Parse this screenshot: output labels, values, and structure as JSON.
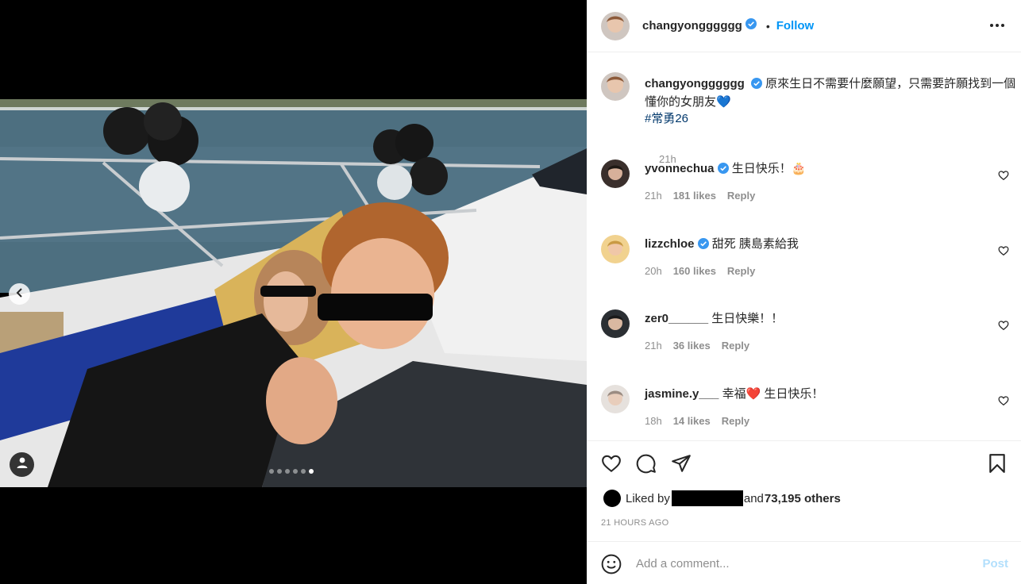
{
  "post": {
    "author": "changyongggggg",
    "follow_label": "Follow",
    "separator": "•",
    "caption_text": "原來生日不需要什麼願望，只需要許願找到一個懂你的女朋友💙",
    "hashtag": "#常勇26",
    "caption_time": "21h"
  },
  "media": {
    "slide_count": 6,
    "active_slide": 6
  },
  "comments": [
    {
      "user": "yvonnechua",
      "verified": true,
      "text": "生日快乐！🎂",
      "time": "21h",
      "likes": "181 likes",
      "reply": "Reply"
    },
    {
      "user": "lizzchloe",
      "verified": true,
      "text": "甜死 胰島素給我",
      "time": "20h",
      "likes": "160 likes",
      "reply": "Reply"
    },
    {
      "user": "zer0______",
      "verified": false,
      "text": "生日快樂！！",
      "time": "21h",
      "likes": "36 likes",
      "reply": "Reply"
    },
    {
      "user": "jasmine.y___",
      "verified": false,
      "text": "幸福❤️ 生日快乐！",
      "time": "18h",
      "likes": "14 likes",
      "reply": "Reply"
    }
  ],
  "likes": {
    "prefix": "Liked by",
    "suffix_and": "and",
    "others": "73,195 others"
  },
  "timestamp": "21 HOURS AGO",
  "composer": {
    "placeholder": "Add a comment...",
    "post_label": "Post"
  },
  "icons": {
    "prev": "chevron-left-icon",
    "tag": "user-tag-icon",
    "more": "more-horizontal-icon",
    "verified": "verified-badge-icon",
    "like": "heart-icon",
    "comment": "comment-icon",
    "share": "share-icon",
    "save": "bookmark-icon",
    "emoji": "emoji-icon"
  },
  "colors": {
    "link": "#0095f6",
    "hashtag": "#00376b",
    "muted": "#8e8e8e",
    "post_disabled": "#b2dffc"
  }
}
